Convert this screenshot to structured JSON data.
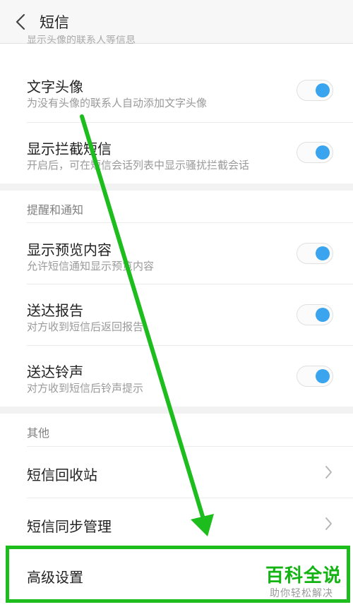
{
  "header": {
    "title": "短信",
    "back_icon": "chevron-left-icon"
  },
  "partial_text": "显示头像的联系人等信息",
  "rows": [
    {
      "label": "文字头像",
      "sub": "为没有头像的联系人自动添加文字头像",
      "toggle_on": true
    },
    {
      "label": "显示拦截短信",
      "sub": "开启后，可在短信会话列表中显示骚扰拦截会话",
      "toggle_on": true
    },
    {
      "label": "显示预览内容",
      "sub": "允许短信通知显示预览内容",
      "toggle_on": true
    },
    {
      "label": "送达报告",
      "sub": "对方收到短信后返回报告",
      "toggle_on": true
    },
    {
      "label": "送达铃声",
      "sub": "对方收到短信后铃声提示",
      "toggle_on": true
    }
  ],
  "sections": {
    "notify": "提醒和通知",
    "other": "其他"
  },
  "nav_items": [
    {
      "label": "短信回收站"
    },
    {
      "label": "短信同步管理"
    },
    {
      "label": "高级设置"
    }
  ],
  "watermark": {
    "title": "百科全说",
    "subtitle": "助你轻松解决"
  },
  "colors": {
    "toggle_knob": "#3aa4ee",
    "highlight": "#1ebd1e",
    "watermark": "#12b312"
  }
}
